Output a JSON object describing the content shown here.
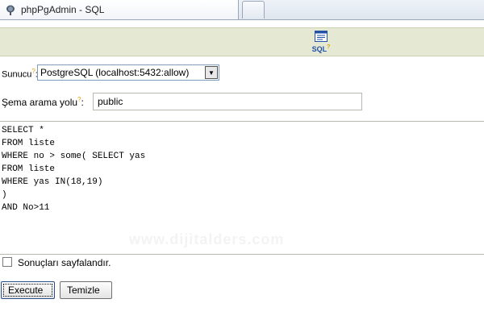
{
  "browser": {
    "tab_title": "phpPgAdmin - SQL"
  },
  "toolbar": {
    "sql_label": "SQL",
    "sql_help_mark": "?"
  },
  "form": {
    "server_label": "Sunucu",
    "server_help_mark": "?",
    "server_label_suffix": ":",
    "server_value": "PostgreSQL (localhost:5432:allow)",
    "schema_label": "Şema arama yolu",
    "schema_help_mark": "?",
    "schema_label_suffix": ":",
    "schema_value": "public",
    "sql_lines": [
      "SELECT *",
      "FROM liste",
      "WHERE no > some( SELECT yas",
      "FROM liste",
      "WHERE yas IN(18,19)",
      ")",
      "AND No>11"
    ],
    "paginate_label": "Sonuçları sayfalandır.",
    "paginate_checked": false,
    "execute_label": "Execute",
    "clear_label": "Temizle"
  },
  "watermark_text": "www.dijitalders.com"
}
